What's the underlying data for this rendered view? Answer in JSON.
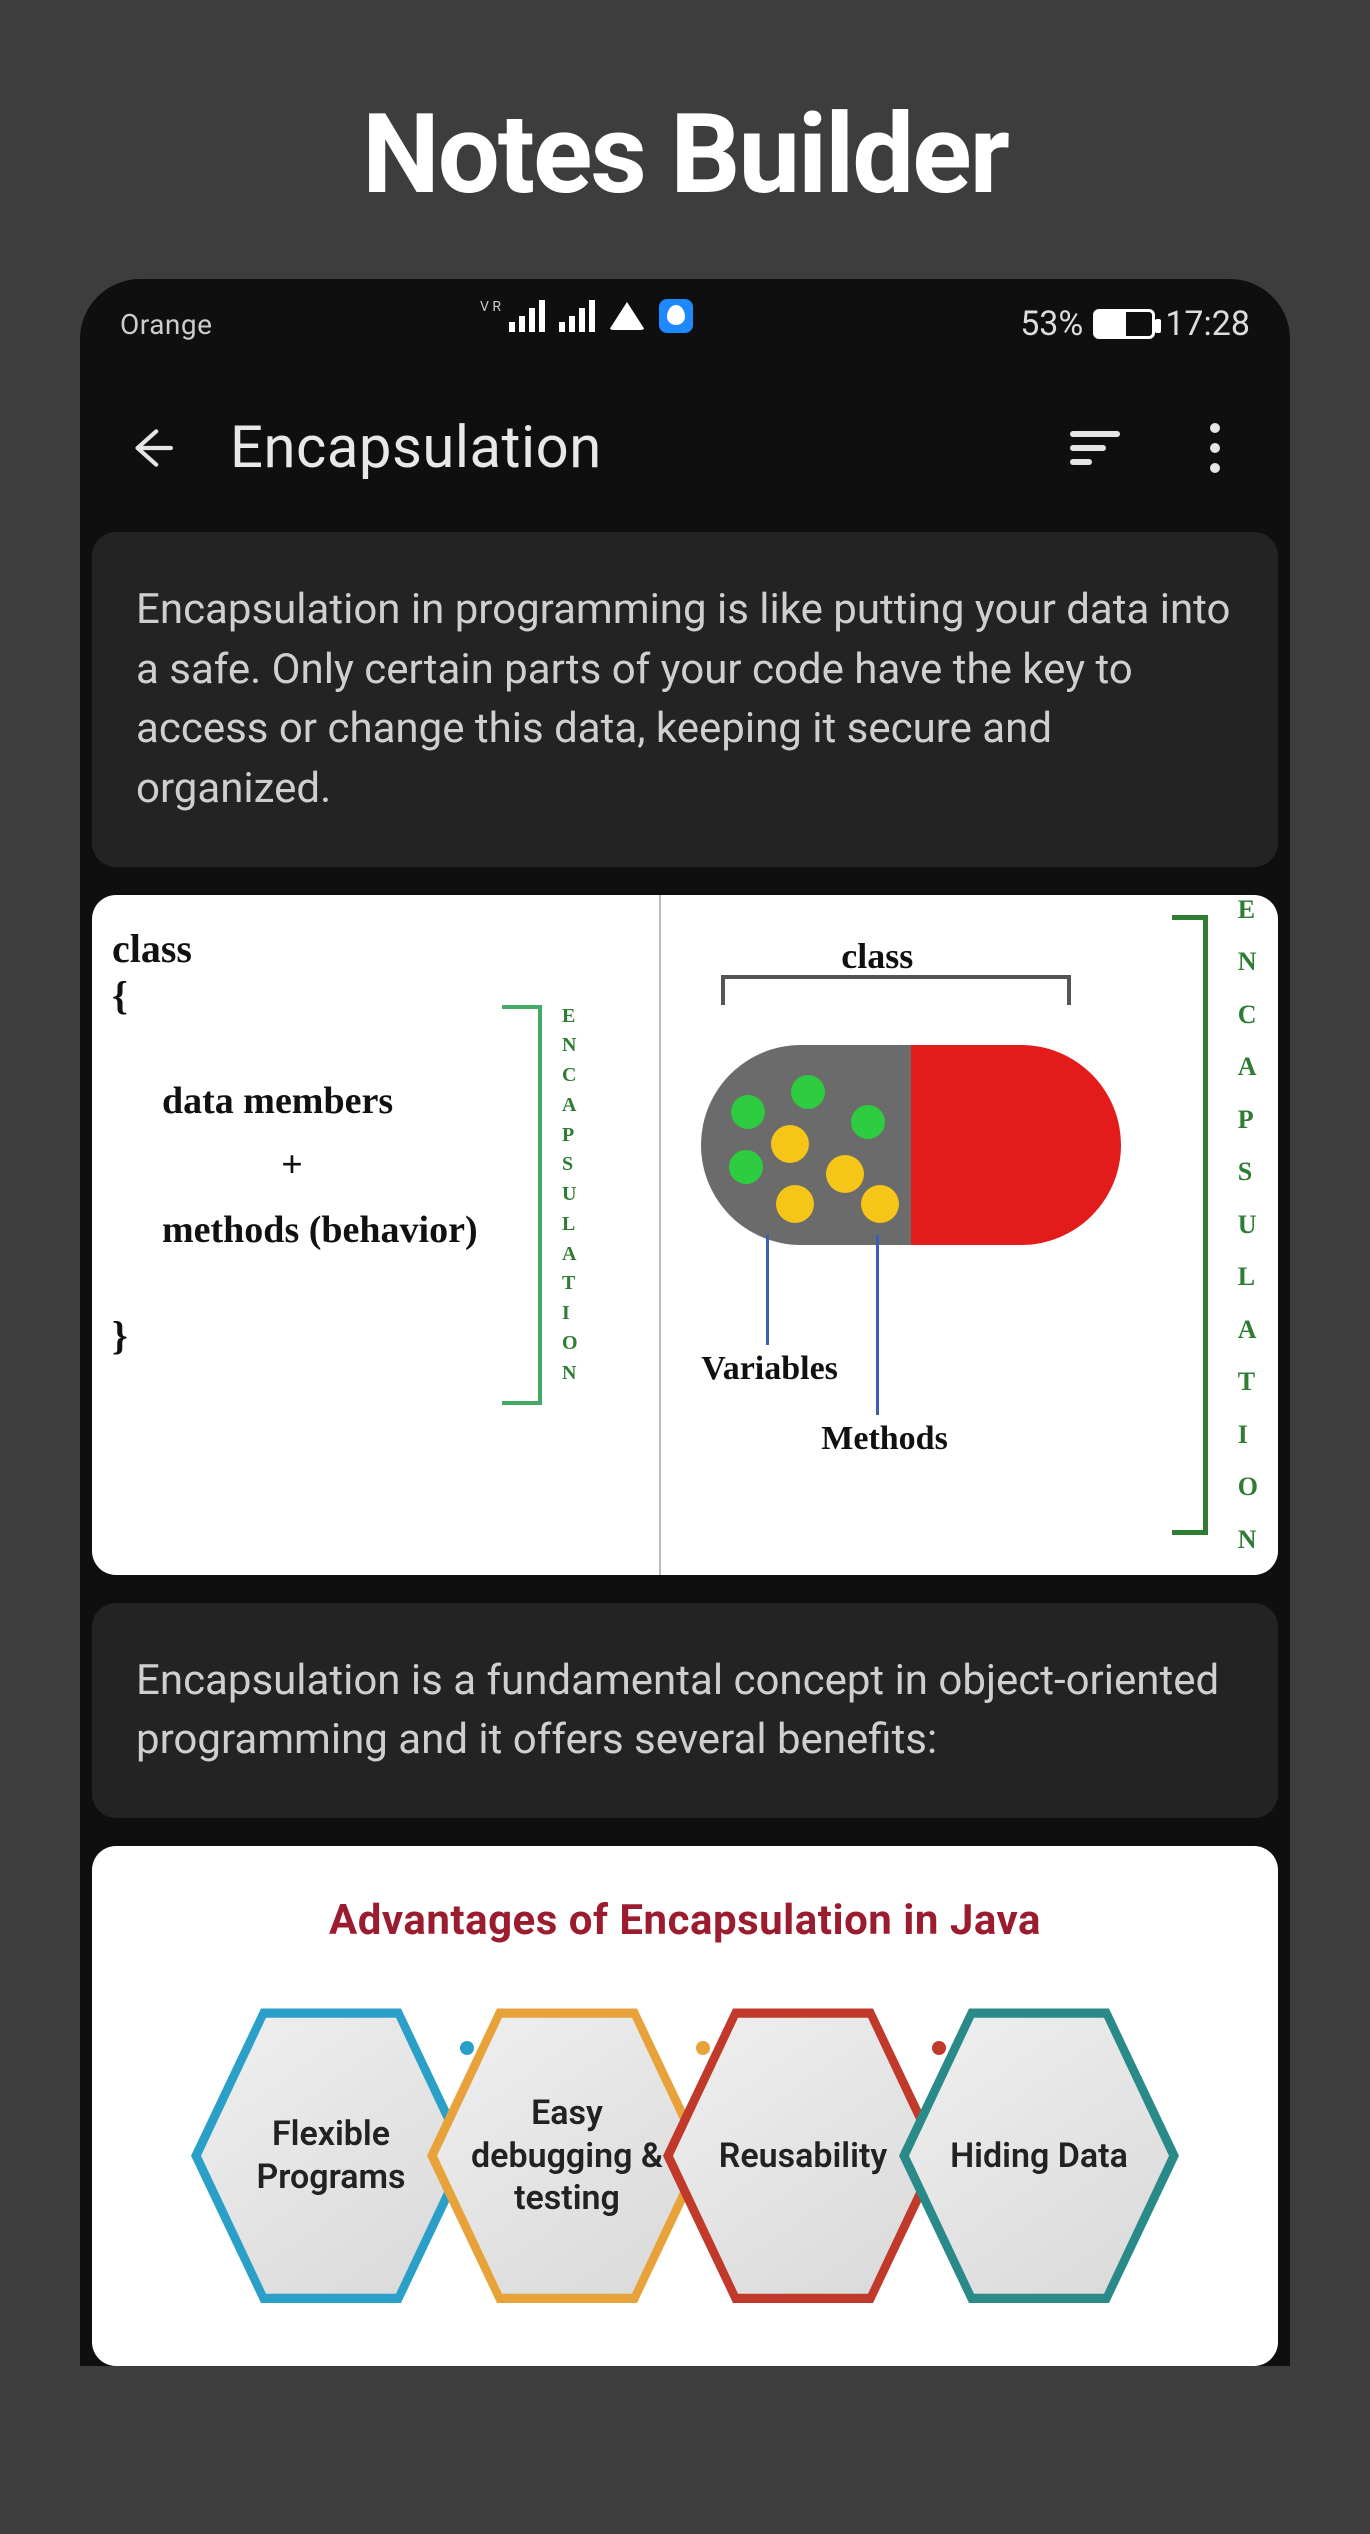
{
  "page_heading": "Notes Builder",
  "status_bar": {
    "carrier": "Orange",
    "battery_percent": "53%",
    "time": "17:28"
  },
  "app_bar": {
    "title": "Encapsulation"
  },
  "cards": {
    "intro_text": "Encapsulation in programming is like putting your data into a safe. Only certain parts of your code have the key to access or change this data, keeping it secure and organized.",
    "benefits_text": "Encapsulation is a fundamental concept in object-oriented programming and it offers several benefits:"
  },
  "diagram1": {
    "keyword_class": "class",
    "brace_open": "{",
    "body_line1": "data members",
    "body_plus": "+",
    "body_line2": "methods (behavior)",
    "brace_close": "}",
    "side_label_letters": [
      "E",
      "N",
      "C",
      "A",
      "P",
      "S",
      "U",
      "L",
      "A",
      "T",
      "I",
      "O",
      "N"
    ],
    "right_class_label": "class",
    "variables_label": "Variables",
    "methods_label": "Methods"
  },
  "diagram2": {
    "title": "Advantages of Encapsulation in Java",
    "hexes": [
      "Flexible Programs",
      "Easy debugging & testing",
      "Reusability",
      "Hiding Data"
    ]
  }
}
